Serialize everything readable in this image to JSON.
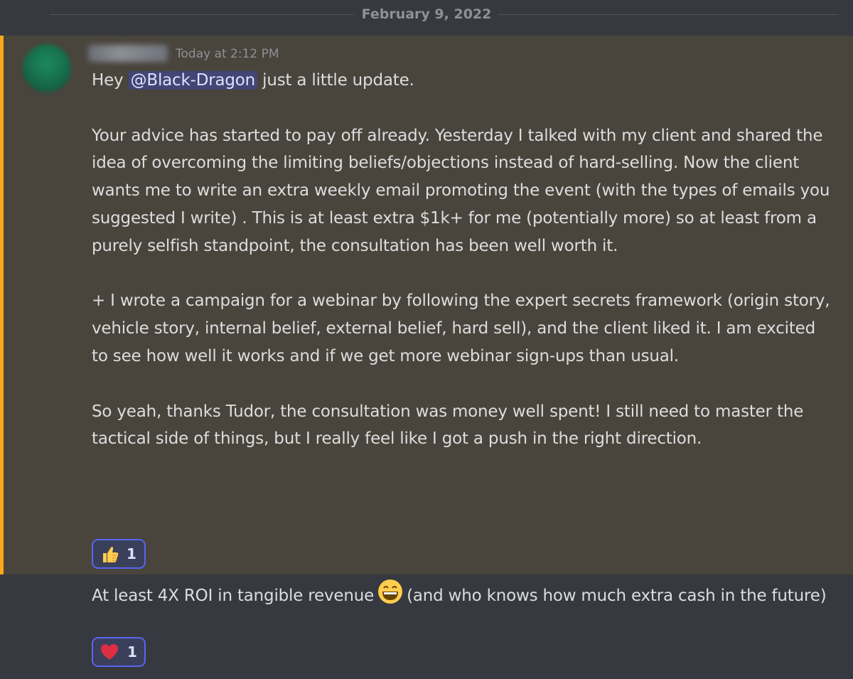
{
  "date_divider": "February 9, 2022",
  "message1": {
    "timestamp": "Today at 2:12 PM",
    "greeting_prefix": "Hey ",
    "mention": "@Black-Dragon",
    "greeting_suffix": " just a little update.",
    "paragraph2": "Your advice has started to pay off already. Yesterday I talked with my client and shared the idea of overcoming the limiting beliefs/objections instead of hard-selling. Now the client wants me to write an extra weekly email promoting the event (with the types of emails you suggested I write) . This is at least extra $1k+ for me (potentially more) so at least from a purely selfish standpoint, the consultation has been well worth it.",
    "paragraph3": "+ I wrote a campaign for a webinar by following the expert secrets framework (origin story, vehicle story, internal belief, external belief, hard sell), and the client liked it. I am excited to see how well it works and if we get more webinar sign-ups than usual.",
    "paragraph4": "So yeah, thanks Tudor, the consultation was money well spent! I still need to master the tactical side of things, but I really feel like I got a push in the right direction.",
    "reaction": {
      "emoji": "thumbs-up-icon",
      "count": "1"
    }
  },
  "message2": {
    "text_before": "At least 4X ROI in tangible revenue",
    "emoji": "grinning-face-icon",
    "text_after": "(and who knows how much extra cash in the future)",
    "reaction": {
      "emoji": "red-heart-icon",
      "count": "1"
    }
  },
  "colors": {
    "background": "#36393f",
    "highlight": "#49443c",
    "highlight_bar": "#faa81a",
    "mention_bg": "#414675",
    "reaction_border": "#5865f2"
  }
}
